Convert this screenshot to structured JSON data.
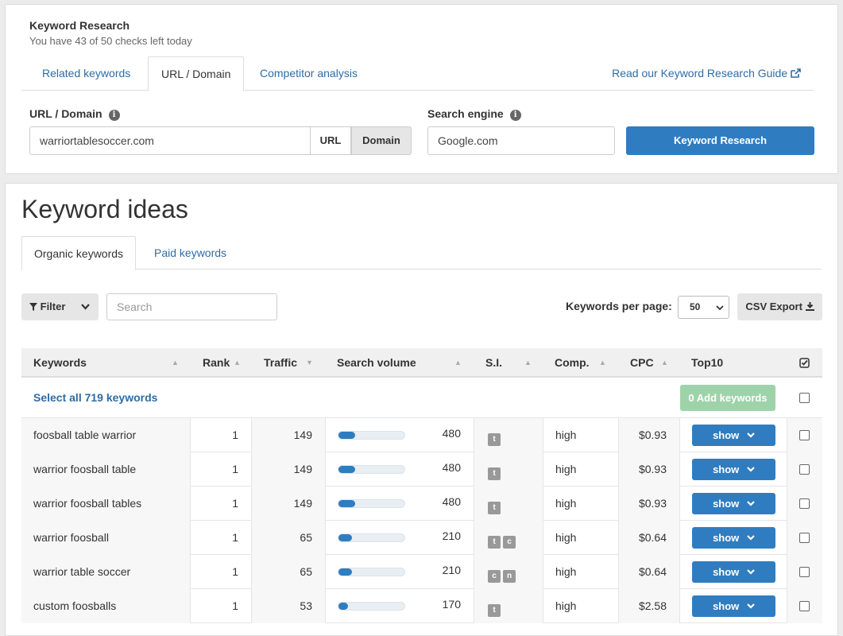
{
  "header": {
    "title": "Keyword Research",
    "subtitle": "You have 43 of 50 checks left today",
    "tabs": [
      {
        "label": "Related keywords"
      },
      {
        "label": "URL / Domain"
      },
      {
        "label": "Competitor analysis"
      }
    ],
    "guide_link": "Read our Keyword Research Guide",
    "url_label": "URL / Domain",
    "url_value": "warriortablesoccer.com",
    "url_btn": "URL",
    "domain_btn": "Domain",
    "engine_label": "Search engine",
    "engine_value": "Google.com",
    "research_btn": "Keyword Research"
  },
  "ideas": {
    "title": "Keyword ideas",
    "tabs": [
      {
        "label": "Organic keywords"
      },
      {
        "label": "Paid keywords"
      }
    ],
    "filter_label": "Filter",
    "search_placeholder": "Search",
    "per_page_label": "Keywords per page:",
    "per_page_value": "50",
    "csv_label": "CSV Export",
    "columns": {
      "keywords": "Keywords",
      "rank": "Rank",
      "traffic": "Traffic",
      "volume": "Search volume",
      "si": "S.I.",
      "comp": "Comp.",
      "cpc": "CPC",
      "top10": "Top10"
    },
    "select_all": "Select all 719 keywords",
    "add_keywords": "0 Add keywords",
    "show_label": "show",
    "rows": [
      {
        "keyword": "foosball table warrior",
        "rank": "1",
        "traffic": "149",
        "volume": "480",
        "volume_fraction": 0.25,
        "si": [
          "t"
        ],
        "comp": "high",
        "cpc": "$0.93"
      },
      {
        "keyword": "warrior foosball table",
        "rank": "1",
        "traffic": "149",
        "volume": "480",
        "volume_fraction": 0.25,
        "si": [
          "t"
        ],
        "comp": "high",
        "cpc": "$0.93"
      },
      {
        "keyword": "warrior foosball tables",
        "rank": "1",
        "traffic": "149",
        "volume": "480",
        "volume_fraction": 0.25,
        "si": [
          "t"
        ],
        "comp": "high",
        "cpc": "$0.93"
      },
      {
        "keyword": "warrior foosball",
        "rank": "1",
        "traffic": "65",
        "volume": "210",
        "volume_fraction": 0.2,
        "si": [
          "t",
          "c"
        ],
        "comp": "high",
        "cpc": "$0.64"
      },
      {
        "keyword": "warrior table soccer",
        "rank": "1",
        "traffic": "65",
        "volume": "210",
        "volume_fraction": 0.2,
        "si": [
          "c",
          "n"
        ],
        "comp": "high",
        "cpc": "$0.64"
      },
      {
        "keyword": "custom foosballs",
        "rank": "1",
        "traffic": "53",
        "volume": "170",
        "volume_fraction": 0.15,
        "si": [
          "t"
        ],
        "comp": "high",
        "cpc": "$2.58"
      }
    ]
  }
}
